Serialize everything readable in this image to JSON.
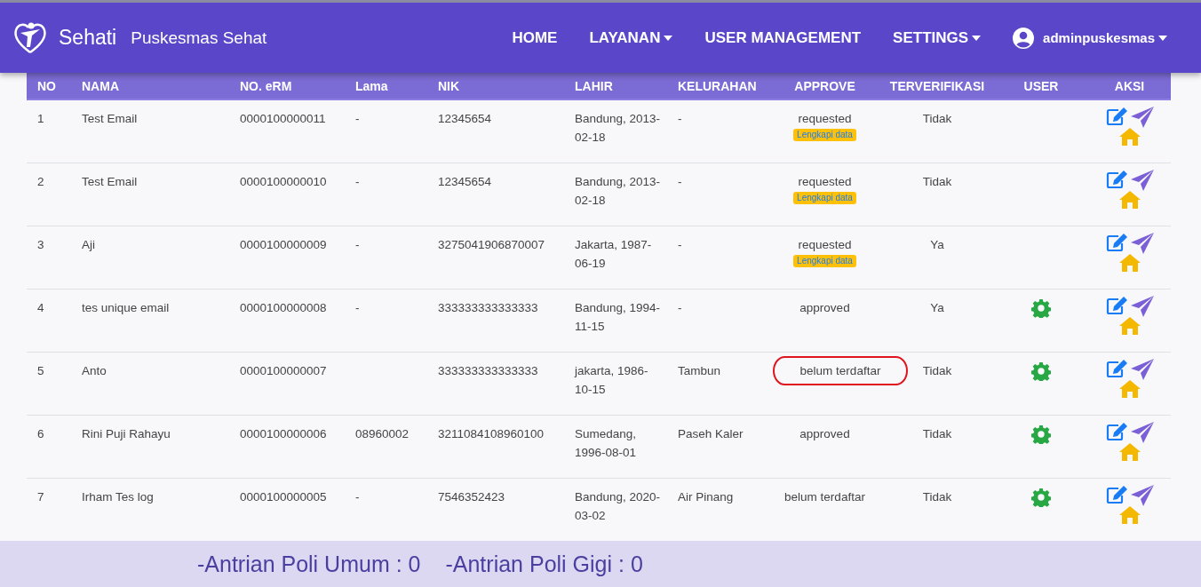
{
  "navbar": {
    "brand": "Sehati",
    "site": "Puskesmas Sehat",
    "menu": [
      {
        "label": "HOME",
        "dropdown": false
      },
      {
        "label": "LAYANAN",
        "dropdown": true
      },
      {
        "label": "USER MANAGEMENT",
        "dropdown": false
      },
      {
        "label": "SETTINGS",
        "dropdown": true
      }
    ],
    "user": "adminpuskesmas"
  },
  "table": {
    "columns": [
      "NO",
      "NAMA",
      "NO. eRM",
      "Lama",
      "NIK",
      "LAHIR",
      "KELURAHAN",
      "APPROVE",
      "TERVERIFIKASI",
      "USER",
      "AKSI"
    ],
    "rows": [
      {
        "no": "1",
        "nama": "Test Email",
        "erm": "0000100000011",
        "lama": "-",
        "nik": "12345654",
        "lahir": "Bandung, 2013-02-18",
        "kelurahan": "-",
        "approve": "requested",
        "badge": "Lengkapi data",
        "highlighted": false,
        "verified": "Tidak",
        "user_settings": false
      },
      {
        "no": "2",
        "nama": "Test Email",
        "erm": "0000100000010",
        "lama": "-",
        "nik": "12345654",
        "lahir": "Bandung, 2013-02-18",
        "kelurahan": "-",
        "approve": "requested",
        "badge": "Lengkapi data",
        "highlighted": false,
        "verified": "Tidak",
        "user_settings": false
      },
      {
        "no": "3",
        "nama": "Aji",
        "erm": "0000100000009",
        "lama": "-",
        "nik": "3275041906870007",
        "lahir": "Jakarta, 1987-06-19",
        "kelurahan": "-",
        "approve": "requested",
        "badge": "Lengkapi data",
        "highlighted": false,
        "verified": "Ya",
        "user_settings": false
      },
      {
        "no": "4",
        "nama": "tes unique email",
        "erm": "0000100000008",
        "lama": "-",
        "nik": "333333333333333",
        "lahir": "Bandung, 1994-11-15",
        "kelurahan": "-",
        "approve": "approved",
        "highlighted": false,
        "verified": "Ya",
        "user_settings": true
      },
      {
        "no": "5",
        "nama": "Anto",
        "erm": "0000100000007",
        "nik": "333333333333333",
        "lahir": "jakarta, 1986-10-15",
        "kelurahan": "Tambun",
        "approve": "belum terdaftar",
        "highlighted": true,
        "verified": "Tidak",
        "user_settings": true
      },
      {
        "no": "6",
        "nama": "Rini Puji Rahayu",
        "erm": "0000100000006",
        "lama": "08960002",
        "nik": "3211084108960100",
        "lahir": "Sumedang, 1996-08-01",
        "kelurahan": "Paseh Kaler",
        "approve": "approved",
        "highlighted": false,
        "verified": "Tidak",
        "user_settings": true
      },
      {
        "no": "7",
        "nama": "Irham Tes log",
        "erm": "0000100000005",
        "lama": "-",
        "nik": "7546352423",
        "lahir": "Bandung, 2020-03-02",
        "kelurahan": "Air Pinang",
        "approve": "belum terdaftar",
        "highlighted": false,
        "verified": "Tidak",
        "user_settings": true
      }
    ]
  },
  "footer": [
    "-Antrian Poli Umum : 0",
    "-Antrian Poli Gigi : 0"
  ]
}
